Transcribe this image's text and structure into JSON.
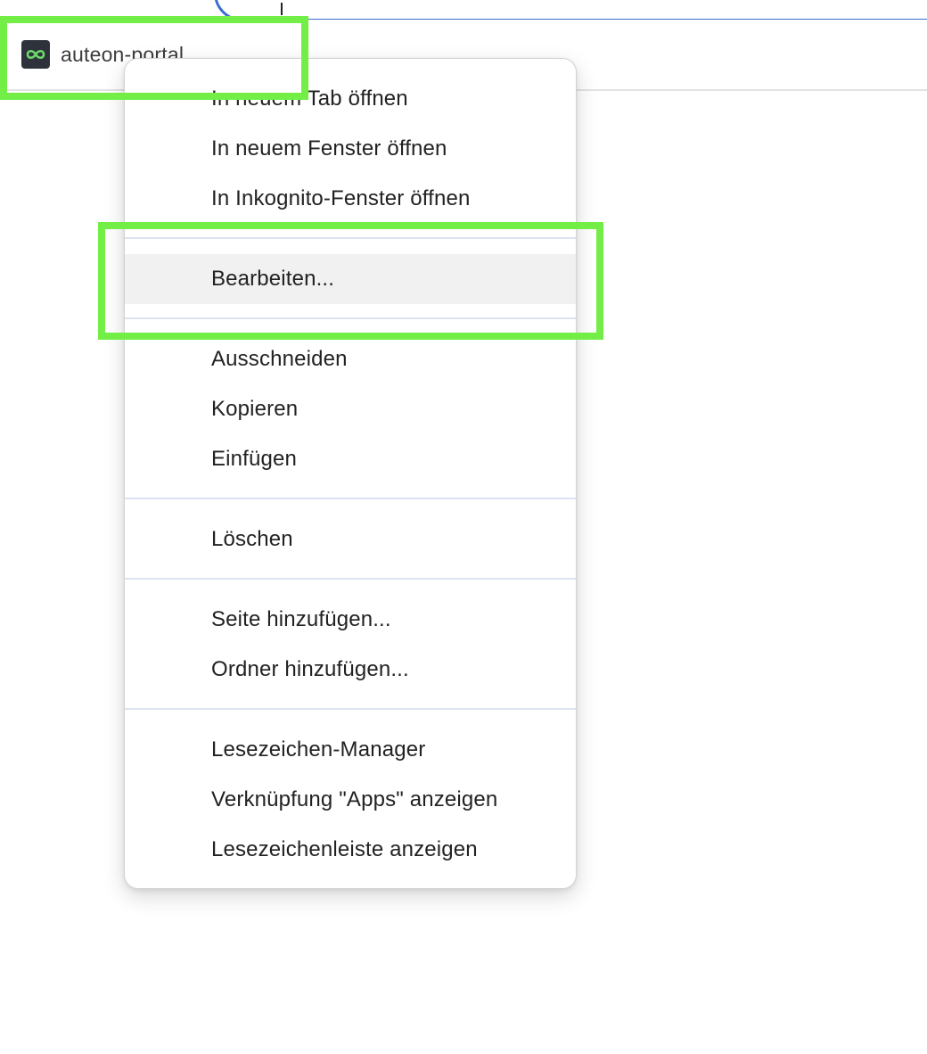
{
  "colors": {
    "highlight": "#73ee47",
    "omnibox_border": "#3a6fd0",
    "favicon_bg": "#2e323a",
    "favicon_glyph": "#6cd86a",
    "menu_hover": "#f1f1f1",
    "separator": "#dbe3f2"
  },
  "bookmarks_bar": {
    "items": [
      {
        "label": "auteon-portal",
        "icon": "infinity-icon"
      }
    ]
  },
  "context_menu": {
    "hovered_item": "Bearbeiten...",
    "groups": [
      {
        "items": [
          "In neuem Tab öffnen",
          "In neuem Fenster öffnen",
          "In Inkognito-Fenster öffnen"
        ]
      },
      {
        "items": [
          "Bearbeiten..."
        ]
      },
      {
        "items": [
          "Ausschneiden",
          "Kopieren",
          "Einfügen"
        ]
      },
      {
        "items": [
          "Löschen"
        ]
      },
      {
        "items": [
          "Seite hinzufügen...",
          "Ordner hinzufügen..."
        ]
      },
      {
        "items": [
          "Lesezeichen-Manager",
          "Verknüpfung \"Apps\" anzeigen",
          "Lesezeichenleiste anzeigen"
        ]
      }
    ]
  }
}
